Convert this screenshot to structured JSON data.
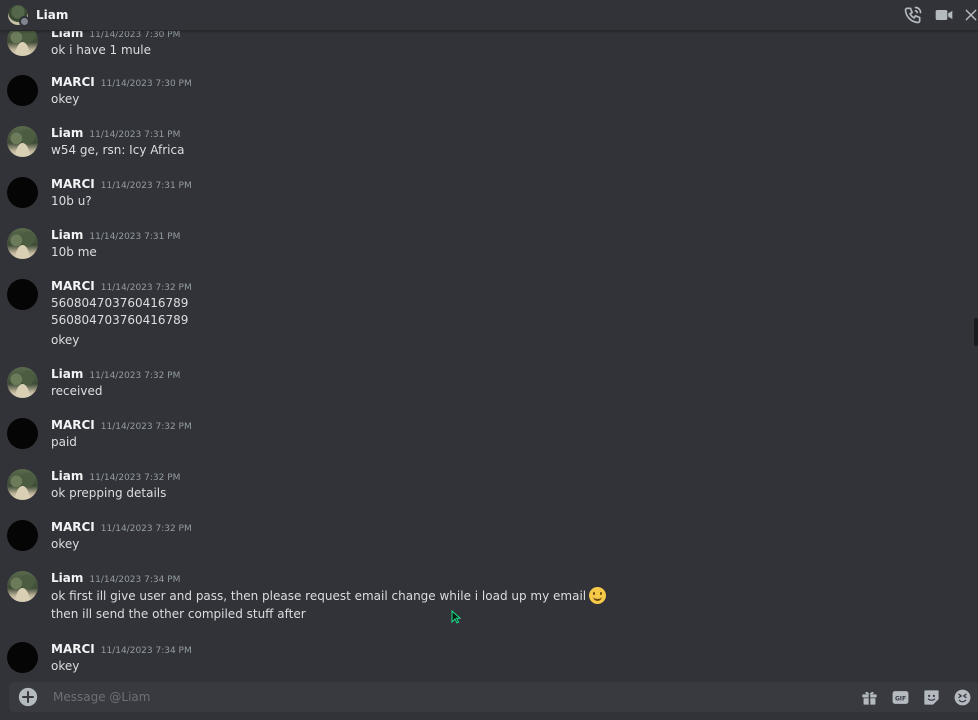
{
  "header": {
    "title": "Liam"
  },
  "messages": [
    {
      "author": "Liam",
      "time": "11/14/2023 7:30 PM",
      "avatar": "liam",
      "lines": [
        "ok i have 1 mule"
      ]
    },
    {
      "author": "MARCI",
      "time": "11/14/2023 7:30 PM",
      "avatar": "marci",
      "lines": [
        "okey"
      ]
    },
    {
      "author": "Liam",
      "time": "11/14/2023 7:31 PM",
      "avatar": "liam",
      "lines": [
        "w54 ge, rsn: Icy Africa"
      ]
    },
    {
      "author": "MARCI",
      "time": "11/14/2023 7:31 PM",
      "avatar": "marci",
      "lines": [
        "10b u?"
      ]
    },
    {
      "author": "Liam",
      "time": "11/14/2023 7:31 PM",
      "avatar": "liam",
      "lines": [
        "10b me"
      ]
    },
    {
      "author": "MARCI",
      "time": "11/14/2023 7:32 PM",
      "avatar": "marci",
      "lines": [
        "560804703760416789",
        "560804703760416789",
        "okey"
      ]
    },
    {
      "author": "Liam",
      "time": "11/14/2023 7:32 PM",
      "avatar": "liam",
      "lines": [
        "received"
      ]
    },
    {
      "author": "MARCI",
      "time": "11/14/2023 7:32 PM",
      "avatar": "marci",
      "lines": [
        "paid"
      ]
    },
    {
      "author": "Liam",
      "time": "11/14/2023 7:32 PM",
      "avatar": "liam",
      "lines": [
        "ok prepping details"
      ]
    },
    {
      "author": "MARCI",
      "time": "11/14/2023 7:32 PM",
      "avatar": "marci",
      "lines": [
        "okey"
      ]
    },
    {
      "author": "Liam",
      "time": "11/14/2023 7:34 PM",
      "avatar": "liam",
      "lines": [
        "ok first ill give user and pass, then please request email change while i load up my email",
        "then ill send the other compiled stuff after"
      ],
      "emoji": "slightly-smiling-face-emoji"
    },
    {
      "author": "MARCI",
      "time": "11/14/2023 7:34 PM",
      "avatar": "marci",
      "lines": [
        "okey"
      ]
    }
  ],
  "composer": {
    "placeholder": "Message @Liam"
  },
  "icons": {
    "call": "phone-call-icon",
    "video": "video-camera-icon",
    "close": "close-icon",
    "add": "add-attachment-icon",
    "gift": "gift-icon",
    "gif": "gif-icon",
    "sticker": "sticker-icon",
    "emoji": "emoji-picker-icon"
  },
  "colors": {
    "background": "#313338",
    "composer": "#383a40",
    "text": "#dbdee1",
    "muted": "#949ba4"
  }
}
